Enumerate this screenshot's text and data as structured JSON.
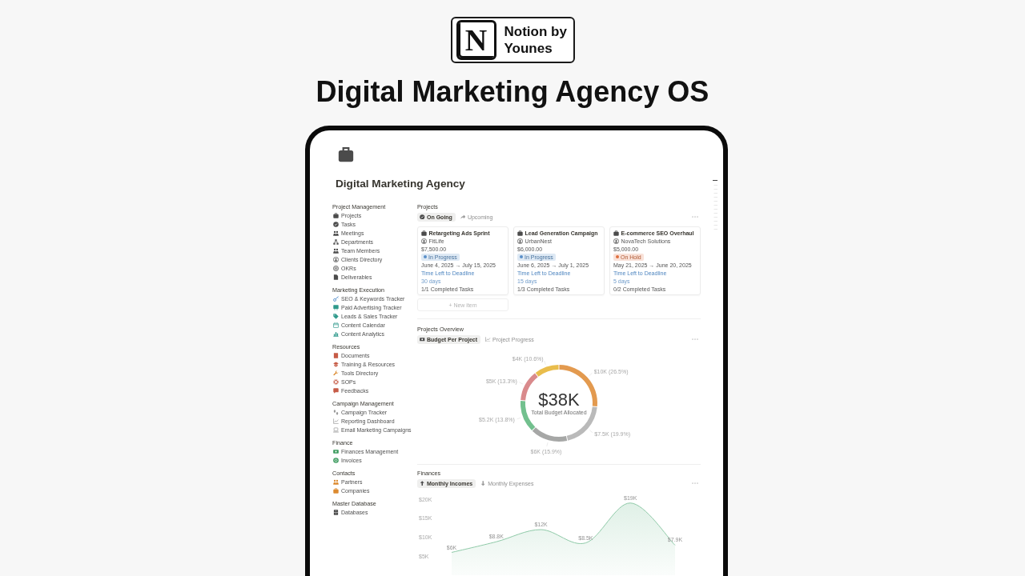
{
  "header": {
    "logo_letter": "N",
    "logo_text": "Notion by Younes",
    "title": "Digital Marketing Agency OS"
  },
  "page": {
    "title": "Digital Marketing Agency"
  },
  "sidebar": {
    "sections": [
      {
        "heading": "Project Management",
        "items": [
          "Projects",
          "Tasks",
          "Meetings",
          "Departments",
          "Team Members",
          "Clients Directory",
          "OKRs",
          "Deliverables"
        ]
      },
      {
        "heading": "Marketing Execution",
        "items": [
          "SEO & Keywords Tracker",
          "Paid Advertising Tracker",
          "Leads & Sales Tracker",
          "Content Calendar",
          "Content Analytics"
        ]
      },
      {
        "heading": "Resources",
        "items": [
          "Documents",
          "Training & Resources",
          "Tools Directory",
          "SOPs",
          "Feedbacks"
        ]
      },
      {
        "heading": "Campaign Management",
        "items": [
          "Campaign Tracker",
          "Reporting Dashboard",
          "Email Marketing Campaigns"
        ]
      },
      {
        "heading": "Finance",
        "items": [
          "Finances Management",
          "Invoices"
        ]
      },
      {
        "heading": "Contacts",
        "items": [
          "Partners",
          "Companies"
        ]
      },
      {
        "heading": "Master Database",
        "items": [
          "Databases"
        ]
      }
    ]
  },
  "projects": {
    "heading": "Projects",
    "tabs": [
      {
        "label": "On Going",
        "selected": true
      },
      {
        "label": "Upcoming",
        "selected": false
      }
    ],
    "cards": [
      {
        "title": "Retargeting Ads Sprint",
        "client": "FitLife",
        "budget": "$7,500.00",
        "status": {
          "label": "In Progress",
          "color": "#5a8fc8"
        },
        "dates": "June 4, 2025 → July 15, 2025",
        "deadline_label": "Time Left to Deadline",
        "days_left": "30 days",
        "tasks": "1/1 Completed Tasks"
      },
      {
        "title": "Lead Generation Campaign",
        "client": "UrbanNest",
        "budget": "$6,000.00",
        "status": {
          "label": "In Progress",
          "color": "#5a8fc8"
        },
        "dates": "June 6, 2025 → July 1, 2025",
        "deadline_label": "Time Left to Deadline",
        "days_left": "15 days",
        "tasks": "1/3 Completed Tasks"
      },
      {
        "title": "E-commerce SEO Overhaul",
        "client": "NovaTech Solutions",
        "budget": "$5,000.00",
        "status": {
          "label": "On Hold",
          "color": "#e0703f"
        },
        "dates": "May 21, 2025 → June 20, 2025",
        "deadline_label": "Time Left to Deadline",
        "days_left": "5 days",
        "tasks": "0/2 Completed Tasks"
      }
    ],
    "new_item": "+ New item"
  },
  "projects_overview": {
    "heading": "Projects Overview",
    "tabs": [
      {
        "label": "Budget Per Project",
        "selected": true
      },
      {
        "label": "Project Progress",
        "selected": false
      }
    ],
    "total_value": "$38K",
    "total_label": "Total Budget Allocated",
    "chart_data": {
      "type": "donut",
      "values": [
        10000,
        7500,
        6000,
        5200,
        5000,
        4000
      ],
      "colors": [
        "#e39a4f",
        "#bababa",
        "#a6a7a6",
        "#72c08e",
        "#d98a8c",
        "#e9bd4c"
      ],
      "value_labels": [
        "$10K (26.5%)",
        "$7.5K (19.9%)",
        "$6K (15.9%)",
        "$5.2K (13.8%)",
        "$5K (13.3%)",
        "$4K (10.6%)"
      ]
    }
  },
  "finances": {
    "heading": "Finances",
    "tabs": [
      {
        "label": "Monthly Incomes",
        "selected": true
      },
      {
        "label": "Monthly Expenses",
        "selected": false
      }
    ],
    "chart_data": {
      "type": "area",
      "categories": [
        null,
        null,
        null,
        null,
        null,
        null
      ],
      "series": [
        {
          "color": "#8fcaa8",
          "values": [
            6000,
            8800,
            12000,
            8500,
            19000,
            7900
          ]
        }
      ],
      "ylim": [
        0,
        20000
      ],
      "yticks": [
        {
          "value": 5000,
          "label": "$5K"
        },
        {
          "value": 10000,
          "label": "$10K"
        },
        {
          "value": 15000,
          "label": "$15K"
        },
        {
          "value": 20000,
          "label": "$20K"
        }
      ],
      "value_labels": [
        "$6K",
        "$8.8K",
        "$12K",
        "$8.5K",
        "$19K",
        "$7.9K"
      ]
    }
  }
}
